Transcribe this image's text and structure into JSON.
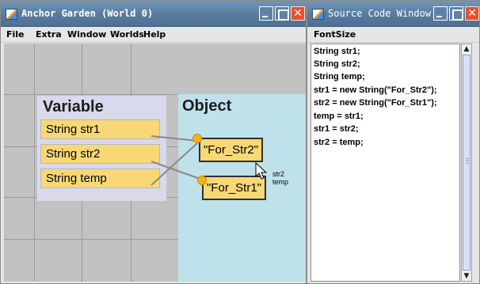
{
  "main_window": {
    "title": "Anchor Garden (World 0)",
    "menu": [
      "File",
      "Extra",
      "Window",
      "Worlds",
      "Help"
    ],
    "variable_area": {
      "title": "Variable",
      "variables": [
        {
          "label": "String  str1"
        },
        {
          "label": "String  str2"
        },
        {
          "label": "String  temp"
        }
      ]
    },
    "object_area": {
      "title": "Object",
      "objects": [
        {
          "label": "\"For_Str2\""
        },
        {
          "label": "\"For_Str1\""
        }
      ],
      "tooltip_lines": [
        "str2",
        "temp"
      ]
    }
  },
  "source_window": {
    "title": "Source Code Window",
    "menu": [
      "FontSize"
    ],
    "code_lines": [
      "String str1;",
      "String str2;",
      "String temp;",
      "str1 = new String(\"For_Str2\");",
      "str2 = new String(\"For_Str1\");",
      "temp = str1;",
      "str1 = str2;",
      "str2 = temp;"
    ]
  },
  "icons": {
    "app": "java-cup-icon",
    "minimize": "minimize-icon",
    "maximize": "maximize-icon",
    "close": "close-icon",
    "cursor": "pointer-cursor-icon",
    "scroll_up": "scroll-up-arrow-icon",
    "scroll_down": "scroll-down-arrow-icon"
  },
  "colors": {
    "titlebar": "#587b9d",
    "close_button": "#e8502e",
    "variable_panel": "#d9d9ec",
    "object_panel": "#bfe1ea",
    "box_fill": "#f8d876",
    "anchor_dot": "#f2b51f"
  }
}
